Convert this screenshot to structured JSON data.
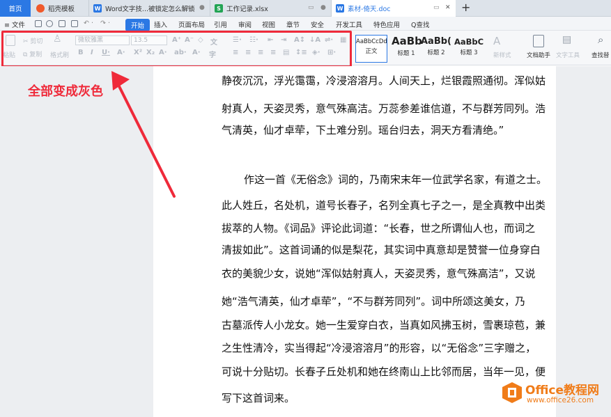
{
  "tabs": {
    "home": "首页",
    "items": [
      {
        "label": "稻壳模板"
      },
      {
        "label": "Word文字技...被锁定怎么解锁"
      },
      {
        "label": "工作记录.xlsx"
      },
      {
        "label": "素材-倚天.doc"
      }
    ],
    "new_tab": "+"
  },
  "menu": {
    "file": "≡ 文件",
    "items": [
      "开始",
      "插入",
      "页面布局",
      "引用",
      "审阅",
      "视图",
      "章节",
      "安全",
      "开发工具",
      "特色应用"
    ],
    "search": "Q查找"
  },
  "ribbon": {
    "paste": "粘贴",
    "cut": "剪切",
    "copy": "复制",
    "format_painter": "格式刷",
    "font_name": "微软雅黑",
    "font_size": "13.5",
    "styles": [
      {
        "preview": "AaBbCcDd",
        "caption": "正文"
      },
      {
        "preview": "AaBb",
        "caption": "标题 1"
      },
      {
        "preview": "AaBb(",
        "caption": "标题 2"
      },
      {
        "preview": "AaBbC",
        "caption": "标题 3"
      }
    ],
    "new_style": "新样式",
    "doc_assistant": "文档助手",
    "text_tools": "文字工具",
    "find_replace": "查找替"
  },
  "annotation": "全部变成灰色",
  "document": {
    "paragraphs": [
      "静夜沉沉，浮光霭霭，冷浸溶溶月。人间天上，烂银霞照通彻。浑似姑",
      "射真人，天姿灵秀，意气殊高洁。万蕊参差谁信道，不与群芳同列。浩",
      "气清英，仙才卓荦，下土难分别。瑶台归去，洞天方看清绝。”",
      "作这一首《无俗念》词的，乃南宋末年一位武学名家，有道之士。",
      "此人姓丘，名处机，道号长春子，名列全真七子之一，是全真教中出类",
      "拔萃的人物。《词品》评论此词道：“长春，世之所谓仙人也，而词之",
      "清拔如此”。这首词诵的似是梨花，其实词中真意却是赞誉一位身穿白",
      "衣的美貌少女，说她“浑似姑射真人，天姿灵秀，意气殊高洁”，又说",
      "她“浩气清英，仙才卓荦”，“不与群芳同列”。词中所颂这美女，乃",
      "古墓派传人小龙女。她一生爱穿白衣，当真如风拂玉树，雪裹琼苞，兼",
      "之生性清冷，实当得起“冷浸溶溶月”的形容，以“无俗念”三字赠之，",
      "可说十分贴切。长春子丘处机和她在终南山上比邻而居，当年一见，便",
      "写下这首词来。"
    ]
  },
  "watermark": {
    "line1": "Office教程网",
    "line2": "www.office26.com"
  },
  "colors": {
    "accent": "#2b78e4",
    "highlight": "#ef2a3a",
    "watermark": "#f07c19"
  }
}
